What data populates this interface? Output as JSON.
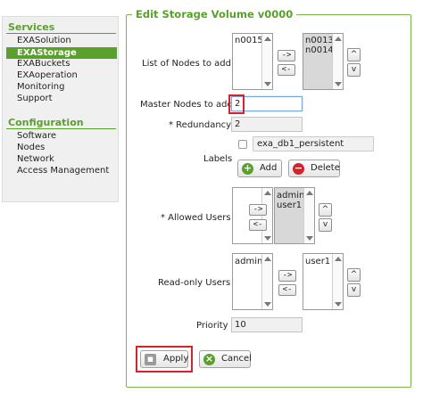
{
  "sidebar": {
    "services_heading": "Services",
    "services": [
      "EXASolution",
      "EXAStorage",
      "EXABuckets",
      "EXAoperation",
      "Monitoring",
      "Support"
    ],
    "configuration_heading": "Configuration",
    "configuration": [
      "Software",
      "Nodes",
      "Network",
      "Access Management"
    ]
  },
  "form": {
    "legend": "Edit Storage Volume v0000",
    "nodes_label": "List of Nodes to add",
    "nodes_available": [
      "n0015"
    ],
    "nodes_selected": [
      "n0013",
      "n0014"
    ],
    "master_label": "Master Nodes to add",
    "master_value": "2",
    "redundancy_label": "* Redundancy",
    "redundancy_value": "2",
    "labels_label": "Labels",
    "label_value": "exa_db1_persistent",
    "add_label": "Add",
    "delete_label": "Delete",
    "allowed_label": "* Allowed Users",
    "allowed_available": [],
    "allowed_selected": [
      "admin",
      "user1"
    ],
    "readonly_label": "Read-only Users",
    "readonly_available": [
      "admin"
    ],
    "readonly_selected": [
      "user1"
    ],
    "priority_label": "Priority",
    "priority_value": "10",
    "apply_label": "Apply",
    "cancel_label": "Cancel",
    "move_right": "->",
    "move_left": "<-",
    "up": "^",
    "down": "v"
  },
  "colors": {
    "accent": "#5aa02c",
    "highlight": "#d4232a"
  }
}
